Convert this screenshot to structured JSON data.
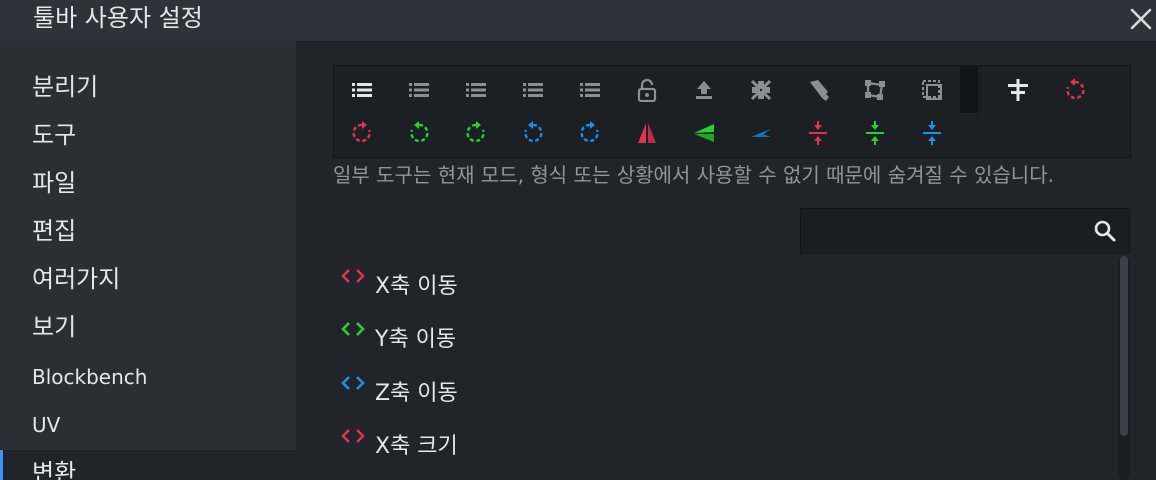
{
  "window": {
    "title": "툴바 사용자 설정"
  },
  "sidebar": {
    "items": [
      {
        "label": "분리기"
      },
      {
        "label": "도구"
      },
      {
        "label": "파일"
      },
      {
        "label": "편집"
      },
      {
        "label": "여러가지"
      },
      {
        "label": "보기"
      },
      {
        "label": "Blockbench"
      },
      {
        "label": "UV"
      },
      {
        "label": "변환",
        "active": true
      }
    ]
  },
  "toolbar": {
    "row1_icons": [
      "list-icon",
      "list-icon",
      "list-icon",
      "list-icon",
      "list-icon",
      "lock-open-icon",
      "upload-icon",
      "compress-icon",
      "brush-icon",
      "transform-icon",
      "selection-icon"
    ],
    "row1_extra_icons": [
      "align-icon",
      "rotate-x-icon"
    ],
    "row2_icons": [
      "rotate-x-icon",
      "rotate-y-icon",
      "rotate-y-icon",
      "rotate-z-icon",
      "rotate-z-icon",
      "flip-x-icon",
      "flip-y-icon",
      "flip-z-icon",
      "center-x-icon",
      "center-y-icon",
      "center-z-icon"
    ]
  },
  "hint": {
    "text": "일부 도구는 현재 모드, 형식 또는 상황에서 사용할 수 없기 때문에 숨겨질 수 있습니다."
  },
  "search": {
    "placeholder": "",
    "value": ""
  },
  "actions": {
    "items": [
      {
        "label": "X축 이동",
        "color": "#e0334f"
      },
      {
        "label": "Y축 이동",
        "color": "#26d130"
      },
      {
        "label": "Z축 이동",
        "color": "#1e8fe6"
      },
      {
        "label": "X축 크기",
        "color": "#e0334f"
      }
    ]
  },
  "colors": {
    "red": "#e0334f",
    "green": "#26d130",
    "blue": "#1e8fe6",
    "accent": "#3e90ff",
    "icon_gray": "#8a8f97",
    "icon_white": "#e6e6e6"
  }
}
